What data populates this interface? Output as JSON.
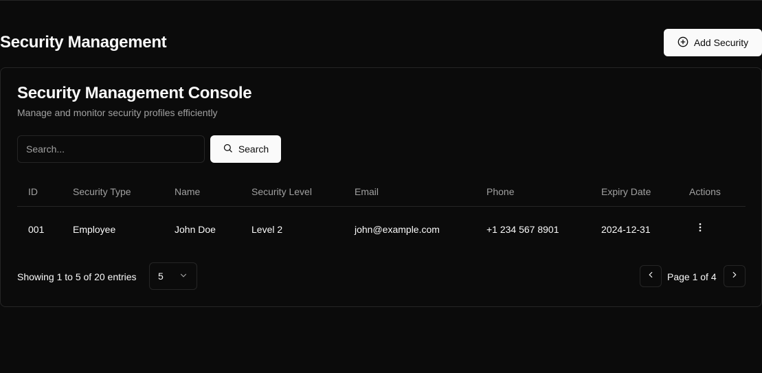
{
  "page": {
    "title": "Security Management",
    "add_button_label": "Add Security"
  },
  "card": {
    "title": "Security Management Console",
    "description": "Manage and monitor security profiles efficiently"
  },
  "search": {
    "placeholder": "Search...",
    "value": "",
    "button_label": "Search"
  },
  "table": {
    "columns": [
      "ID",
      "Security Type",
      "Name",
      "Security Level",
      "Email",
      "Phone",
      "Expiry Date",
      "Actions"
    ],
    "rows": [
      [
        "001",
        "Employee",
        "John Doe",
        "Level 2",
        "john@example.com",
        "+1 234 567 8901",
        "2024-12-31"
      ]
    ]
  },
  "pagination": {
    "showing_text": "Showing 1 to 5 of 20 entries",
    "page_size": "5",
    "page_label": "Page 1 of 4"
  },
  "icons": {
    "add": "plus-circle-icon",
    "search": "search-icon",
    "actions": "more-vertical-icon",
    "select": "chevron-down-icon",
    "prev": "chevron-left-icon",
    "next": "chevron-right-icon"
  },
  "colors": {
    "background": "#0b0b0b",
    "border": "#262626",
    "primary_button": "#fafafa",
    "muted_text": "#a1a1a1"
  }
}
